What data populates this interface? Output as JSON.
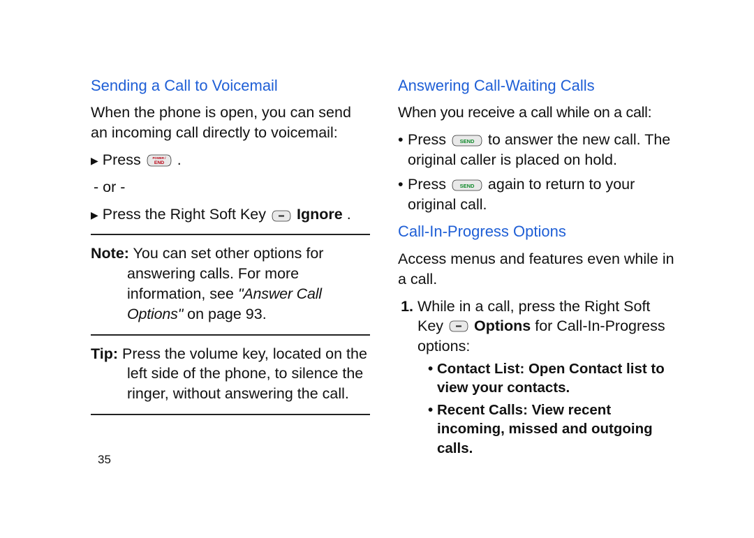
{
  "page_number": "35",
  "left": {
    "heading": "Sending a Call to Voicemail",
    "intro": "When the phone is open, you can send an incoming call directly to voicemail:",
    "press": "Press ",
    "or": "- or -",
    "press_softkey_pre": "Press the Right Soft Key ",
    "ignore": " Ignore",
    "period": ".",
    "note_label": "Note:",
    "note_text_a": " You can set other options for",
    "note_text_b": "answering calls. For more information, see ",
    "note_ref": "\"Answer Call Options\"",
    "note_text_c": " on page 93.",
    "tip_label": "Tip:",
    "tip_text_a": " Press the volume key, located on the",
    "tip_text_b": "left side of the phone, to silence the ringer, without answering the call."
  },
  "right": {
    "heading1": "Answering Call-Waiting Calls",
    "intro1": "When you receive a call while on a call:",
    "b1a": "Press ",
    "b1b": " to answer the new call. The original caller is placed on hold.",
    "b2a": "Press ",
    "b2b": " again to return to your original call.",
    "heading2": "Call-In-Progress Options",
    "intro2": "Access menus and features even while in a call.",
    "step1a": "While in a call, press the Right Soft Key ",
    "step1b": " Options",
    "step1c": " for Call-In-Progress options:",
    "s1_label": "Contact List",
    "s1_text": ": Open Contact list to view your contacts.",
    "s2_label": "Recent Calls",
    "s2_text": ": View recent incoming, missed and outgoing calls."
  }
}
